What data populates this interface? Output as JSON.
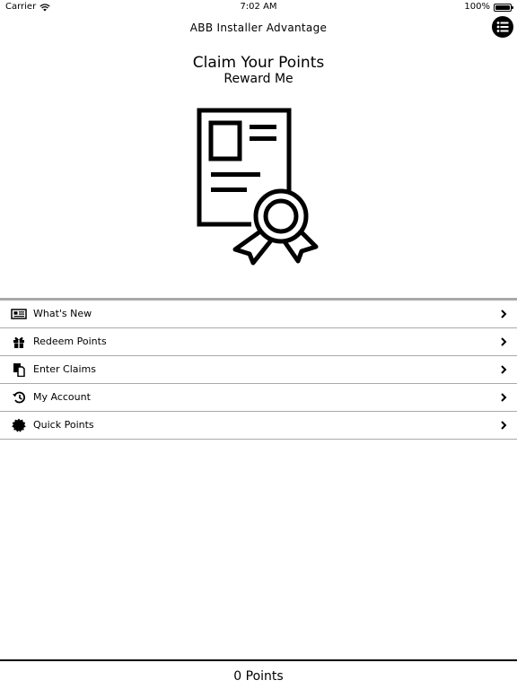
{
  "status_bar": {
    "carrier": "Carrier",
    "time": "7:02 AM",
    "battery": "100%"
  },
  "nav": {
    "title": "ABB Installer Advantage",
    "menu_icon": "list-menu-icon"
  },
  "hero": {
    "title": "Claim Your Points",
    "subtitle": "Reward Me",
    "icon": "certificate-icon"
  },
  "menu": {
    "items": [
      {
        "label": "What's New",
        "icon": "newspaper-icon"
      },
      {
        "label": "Redeem Points",
        "icon": "gift-icon"
      },
      {
        "label": "Enter Claims",
        "icon": "copy-documents-icon"
      },
      {
        "label": "My Account",
        "icon": "history-icon"
      },
      {
        "label": "Quick Points",
        "icon": "badge-seal-icon"
      }
    ]
  },
  "footer": {
    "points": "0 Points"
  }
}
